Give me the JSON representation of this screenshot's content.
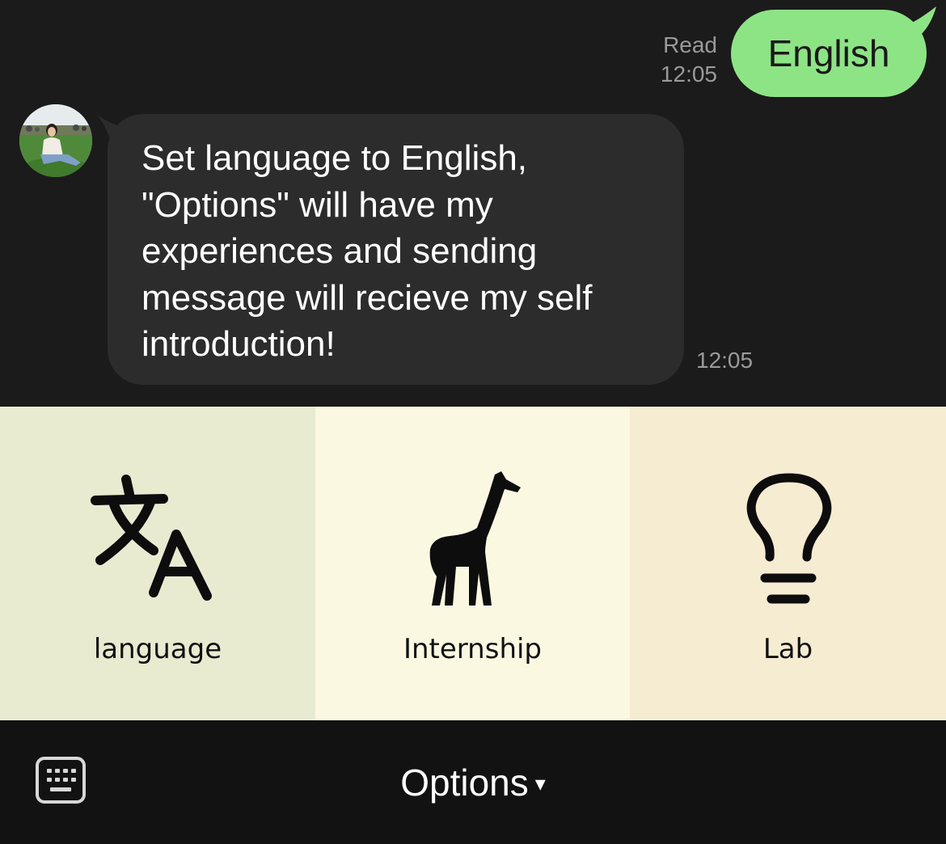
{
  "chat": {
    "outgoing": {
      "text": "English",
      "status": "Read",
      "time": "12:05",
      "bubble_color": "#8de485"
    },
    "incoming": {
      "text": "Set language to English,\n\"Options\" will have my\nexperiences and sending\nmessage will recieve my self\nintroduction!",
      "time": "12:05",
      "bubble_color": "#2c2c2c"
    }
  },
  "menu": {
    "items": [
      {
        "label": "language",
        "icon": "translate-icon",
        "bg": "#e8ebd0"
      },
      {
        "label": "Internship",
        "icon": "giraffe-icon",
        "bg": "#fbf8e2"
      },
      {
        "label": "Lab",
        "icon": "lightbulb-icon",
        "bg": "#f6ecd2"
      }
    ]
  },
  "bottom_bar": {
    "keyboard_icon": "keyboard-icon",
    "toggle_label": "Options",
    "toggle_caret": "▾"
  }
}
